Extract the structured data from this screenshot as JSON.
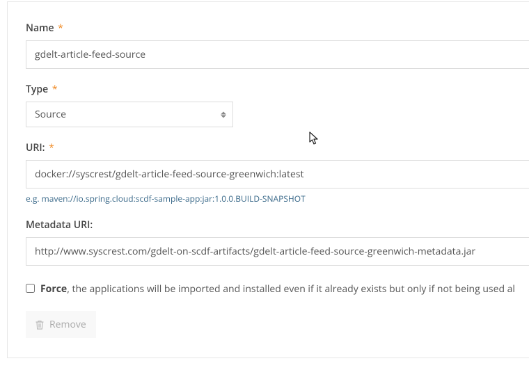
{
  "form": {
    "name": {
      "label": "Name",
      "required": true,
      "value": "gdelt-article-feed-source"
    },
    "type": {
      "label": "Type",
      "required": true,
      "value": "Source"
    },
    "uri": {
      "label": "URI:",
      "required": true,
      "value": "docker://syscrest/gdelt-article-feed-source-greenwich:latest",
      "hint": "e.g. maven://io.spring.cloud:scdf-sample-app:jar:1.0.0.BUILD-SNAPSHOT"
    },
    "metadata_uri": {
      "label": "Metadata URI:",
      "required": false,
      "value": "http://www.syscrest.com/gdelt-on-scdf-artifacts/gdelt-article-feed-source-greenwich-metadata.jar"
    },
    "force": {
      "label_bold": "Force",
      "label_rest": ", the applications will be imported and installed even if it already exists but only if not being used al",
      "checked": false
    },
    "remove_label": "Remove"
  },
  "required_marker": "*"
}
